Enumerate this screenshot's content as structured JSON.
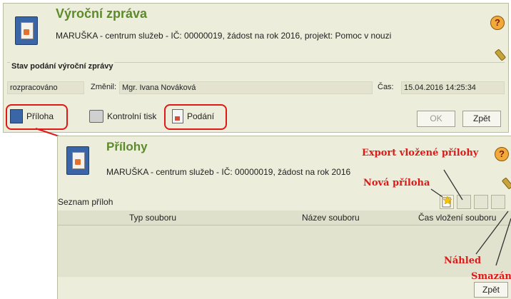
{
  "main_window": {
    "title": "Výroční zpráva",
    "subtitle": "MARUŠKA - centrum služeb - IČ: 00000019, žádost na rok 2016, projekt: Pomoc v nouzi",
    "status_section": {
      "legend": "Stav podání výroční zprávy",
      "status_value": "rozpracováno",
      "changed_label": "Změnil:",
      "changed_value": "Mgr. Ivana Nováková",
      "time_label": "Čas:",
      "time_value": "15.04.2016 14:25:34"
    },
    "toolbar": {
      "attachment_label": "Příloha",
      "control_print_label": "Kontrolní tisk",
      "submit_label": "Podání",
      "ok_label": "OK",
      "back_label": "Zpět"
    }
  },
  "attachments_window": {
    "title": "Přílohy",
    "subtitle": "MARUŠKA - centrum služeb - IČ: 00000019, žádost na rok 2016",
    "list_label": "Seznam příloh",
    "columns": [
      "Typ souboru",
      "Název souboru",
      "Čas vložení souboru"
    ],
    "back_label": "Zpět"
  },
  "annotations": {
    "export": "Export vložené přílohy",
    "new": "Nová příloha",
    "preview": "Náhled",
    "delete": "Smazání"
  },
  "icons": [
    "help-icon",
    "book-icon",
    "key-icon",
    "print-icon",
    "document-icon",
    "new-attachment-icon",
    "export-icon",
    "preview-icon",
    "delete-icon"
  ],
  "colors": {
    "title_green": "#5d8a2c",
    "panel_bg": "#ecedda",
    "annotation_red": "#e01818"
  }
}
